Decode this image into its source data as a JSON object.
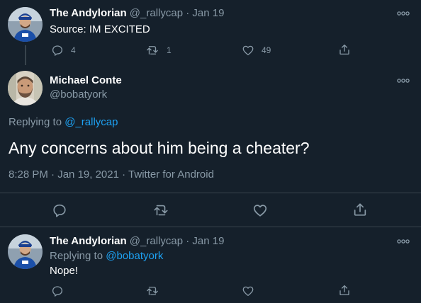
{
  "tweet1": {
    "name": "The Andylorian",
    "handle": "@_rallycap",
    "dot": "·",
    "date": "Jan 19",
    "text": "Source: IM EXCITED",
    "replies": "4",
    "retweets": "1",
    "likes": "49",
    "avatar_icon": "avatar-photo-icon"
  },
  "main_tweet": {
    "name": "Michael Conte",
    "handle": "@bobatyork",
    "replying_prefix": "Replying to",
    "replying_handle": "@_rallycap",
    "text": "Any concerns about him being a cheater?",
    "time": "8:28 PM",
    "dot1": "·",
    "date": "Jan 19, 2021",
    "dot2": "·",
    "client": "Twitter for Android"
  },
  "tweet3": {
    "name": "The Andylorian",
    "handle": "@_rallycap",
    "dot": "·",
    "date": "Jan 19",
    "replying_prefix": "Replying to",
    "replying_handle": "@bobatyork",
    "text": "Nope!"
  },
  "colors": {
    "background": "#15202b",
    "text": "#ffffff",
    "muted": "#8899a6",
    "link": "#1da1f2",
    "divider": "#38444d"
  }
}
